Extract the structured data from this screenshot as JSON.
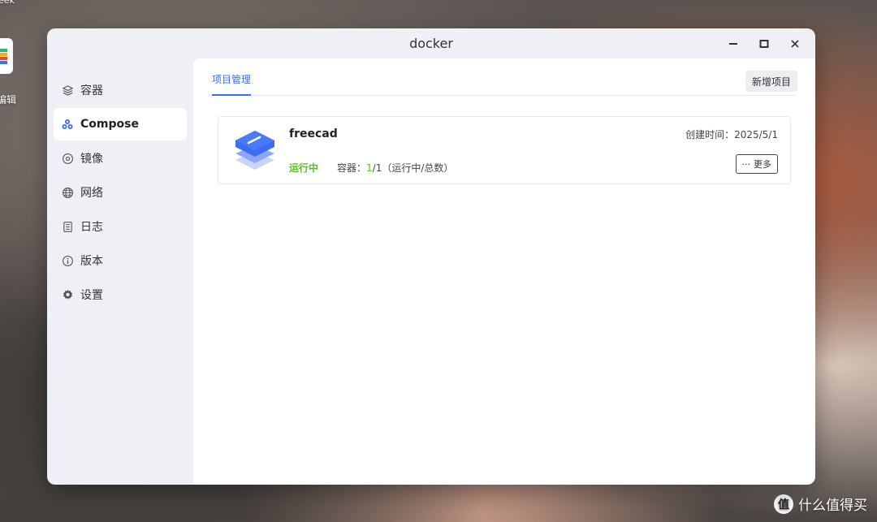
{
  "desktop": {
    "top_label": "eek",
    "app_label": "编辑",
    "watermark": "什么值得买",
    "watermark_logo": "值"
  },
  "window": {
    "title": "docker"
  },
  "sidebar": {
    "items": [
      {
        "label": "容器",
        "icon": "layers-icon"
      },
      {
        "label": "Compose",
        "icon": "compose-icon"
      },
      {
        "label": "镜像",
        "icon": "disc-icon"
      },
      {
        "label": "网络",
        "icon": "globe-icon"
      },
      {
        "label": "日志",
        "icon": "log-icon"
      },
      {
        "label": "版本",
        "icon": "info-icon"
      },
      {
        "label": "设置",
        "icon": "gear-icon"
      }
    ],
    "active_index": 1
  },
  "main": {
    "tab_label": "项目管理",
    "add_button": "新增项目",
    "project": {
      "name": "freecad",
      "created_label": "创建时间：",
      "created_date": "2025/5/1",
      "status": "运行中",
      "containers_label": "容器：",
      "running_count": "1",
      "separator": "/",
      "total_count": "1",
      "containers_suffix": "（运行中/总数）",
      "more_button": "更多",
      "more_icon": "···"
    }
  },
  "colors": {
    "accent": "#3a6cf4",
    "running": "#52c41a"
  }
}
